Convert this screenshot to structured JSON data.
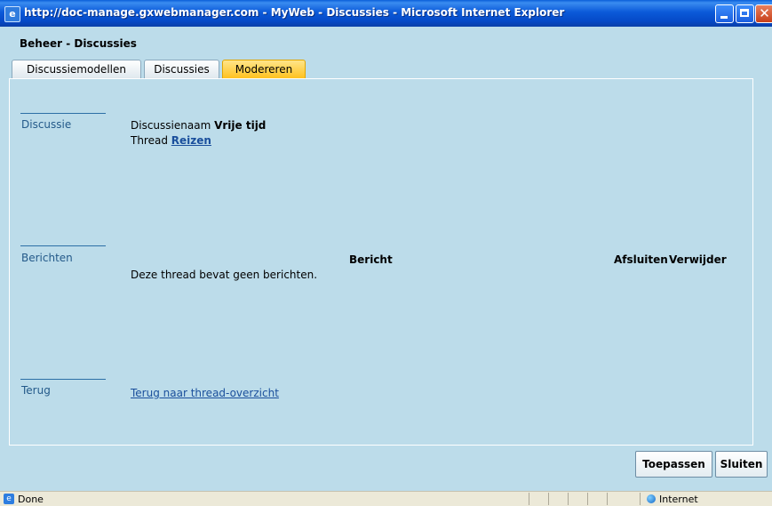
{
  "window": {
    "title": "http://doc-manage.gxwebmanager.com - MyWeb - Discussies - Microsoft Internet Explorer"
  },
  "page": {
    "title": "Beheer - Discussies"
  },
  "tabs": [
    {
      "label": "Discussiemodellen",
      "active": false
    },
    {
      "label": "Discussies",
      "active": false
    },
    {
      "label": "Modereren",
      "active": true
    }
  ],
  "sections": {
    "discussie": {
      "label": "Discussie",
      "name_label": "Discussienaam",
      "name_value": "Vrije tijd",
      "thread_label": "Thread",
      "thread_value": "Reizen"
    },
    "berichten": {
      "label": "Berichten",
      "col_bericht": "Bericht",
      "col_afsluiten": "Afsluiten",
      "col_verwijder": "Verwijder",
      "empty_text": "Deze thread bevat geen berichten."
    },
    "terug": {
      "label": "Terug",
      "link": "Terug naar thread-overzicht"
    }
  },
  "footer": {
    "apply_label": "Toepassen",
    "close_label": "Sluiten"
  },
  "statusbar": {
    "status": "Done",
    "zone": "Internet"
  },
  "colors": {
    "background": "#bcdcea",
    "active_tab": "#ffc21f",
    "link": "#1a4f9c",
    "section_label": "#245a8a"
  }
}
